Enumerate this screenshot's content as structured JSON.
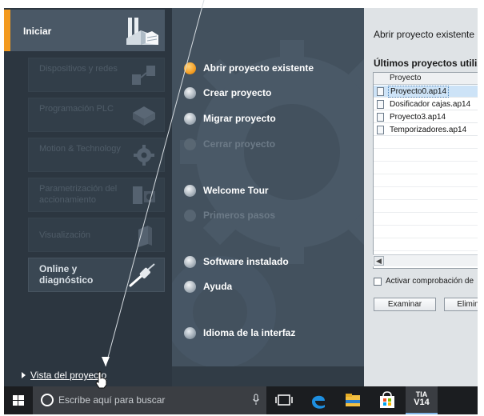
{
  "left_nav": {
    "active": {
      "label": "Iniciar",
      "icon": "start-factory-icon"
    },
    "categories": [
      {
        "label": "Dispositivos y redes",
        "icon": "devices-networks-icon",
        "enabled": false
      },
      {
        "label": "Programación PLC",
        "icon": "plc-programming-icon",
        "enabled": false
      },
      {
        "label": "Motion & Technology",
        "icon": "motion-gear-icon",
        "enabled": false
      },
      {
        "label": "Parametrización del accionamiento",
        "icon": "drive-parameter-icon",
        "enabled": false
      },
      {
        "label": "Visualización",
        "icon": "visualization-icon",
        "enabled": false
      },
      {
        "label": "Online y diagnóstico",
        "icon": "online-diagnostics-icon",
        "enabled": true
      }
    ],
    "project_view_link": "Vista del proyecto"
  },
  "center_menu": [
    {
      "label": "Abrir proyecto existente",
      "enabled": true,
      "selected": true
    },
    {
      "label": "Crear proyecto",
      "enabled": true
    },
    {
      "label": "Migrar proyecto",
      "enabled": true
    },
    {
      "label": "Cerrar proyecto",
      "enabled": false
    },
    {
      "label": "Welcome Tour",
      "enabled": true
    },
    {
      "label": "Primeros pasos",
      "enabled": false
    },
    {
      "label": "Software instalado",
      "enabled": true
    },
    {
      "label": "Ayuda",
      "enabled": true
    },
    {
      "label": "Idioma de la interfaz",
      "enabled": true
    }
  ],
  "right_panel": {
    "title": "Abrir proyecto existente",
    "recent_title": "Últimos proyectos utiliz",
    "column_header": "Proyecto",
    "projects": [
      "Proyecto0.ap14",
      "Dosificador cajas.ap14",
      "Proyecto3.ap14",
      "Temporizadores.ap14"
    ],
    "selected_index": 0,
    "checkbox_label": "Activar comprobación de",
    "browse_button": "Examinar",
    "delete_button": "Elimin"
  },
  "taskbar": {
    "search_placeholder": "Escribe aquí para buscar",
    "tia_icon_label_top": "TIA",
    "tia_icon_label_bottom": "V14"
  },
  "colors": {
    "accent_orange": "#f39a1f",
    "nav_bg": "#2c3640",
    "center_bg": "#43515e",
    "right_bg": "#dfe3e6",
    "taskbar_bg": "#1b1d20"
  }
}
